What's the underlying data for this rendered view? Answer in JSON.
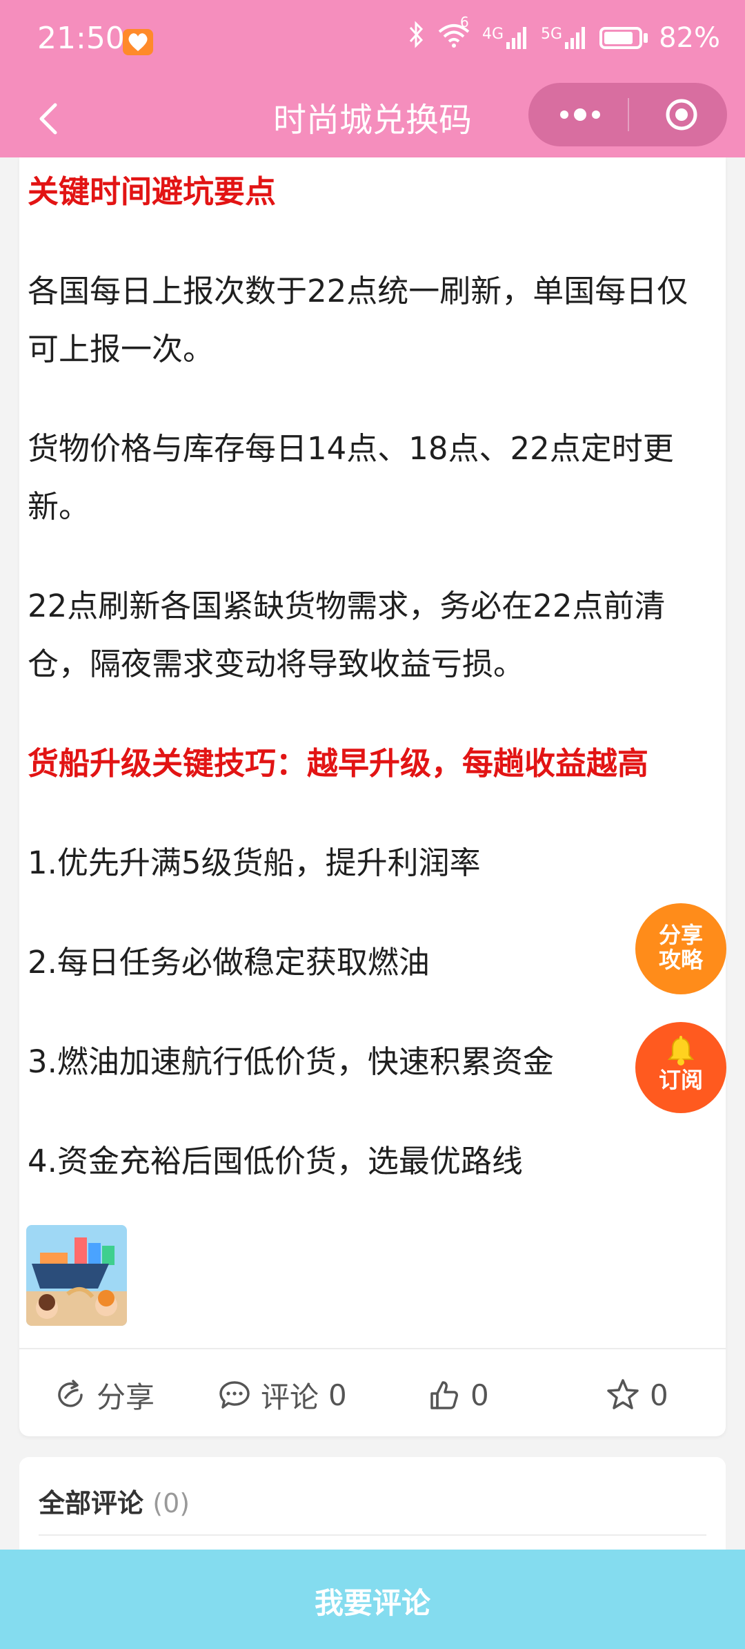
{
  "status_bar": {
    "time": "21:50",
    "network_tags": [
      "6",
      "4G",
      "5G"
    ],
    "battery_percent_text": "82%",
    "battery_level": 0.82
  },
  "header": {
    "title": "时尚城兑换码",
    "bg_color": "#f58ebd",
    "icons": [
      "back-chevron-icon",
      "more-dots-icon",
      "target-icon"
    ]
  },
  "article": {
    "paragraphs": [
      {
        "text": "关键时间避坑要点",
        "style": "red"
      },
      {
        "text": "各国每日上报次数于22点统一刷新，单国每日仅可上报一次。",
        "style": "normal"
      },
      {
        "text": "货物价格与库存每日14点、18点、22点定时更新。",
        "style": "normal"
      },
      {
        "text": "22点刷新各国紧缺货物需求，务必在22点前清仓，隔夜需求变动将导致收益亏损。",
        "style": "normal"
      },
      {
        "text": "货船升级关键技巧：越早升级，每趟收益越高",
        "style": "red"
      },
      {
        "text": "1.优先升满5级货船，提升利润率",
        "style": "normal"
      },
      {
        "text": "2.每日任务必做稳定获取燃油",
        "style": "normal"
      },
      {
        "text": "3.燃油加速航行低价货，快速积累资金",
        "style": "normal"
      },
      {
        "text": "4.资金充裕后囤低价货，选最优路线",
        "style": "normal"
      }
    ],
    "accent_color": "#e21414"
  },
  "actions": {
    "share_label": "分享",
    "comment_label": "评论",
    "comment_count": "0",
    "like_count": "0",
    "favorite_count": "0"
  },
  "floating": {
    "share_line1": "分享",
    "share_line2": "攻略",
    "subscribe_label": "订阅"
  },
  "comments": {
    "heading": "全部评论",
    "count": "(0)"
  },
  "bottom_bar": {
    "button_label": "我要评论",
    "bg_color": "#84dcef"
  }
}
